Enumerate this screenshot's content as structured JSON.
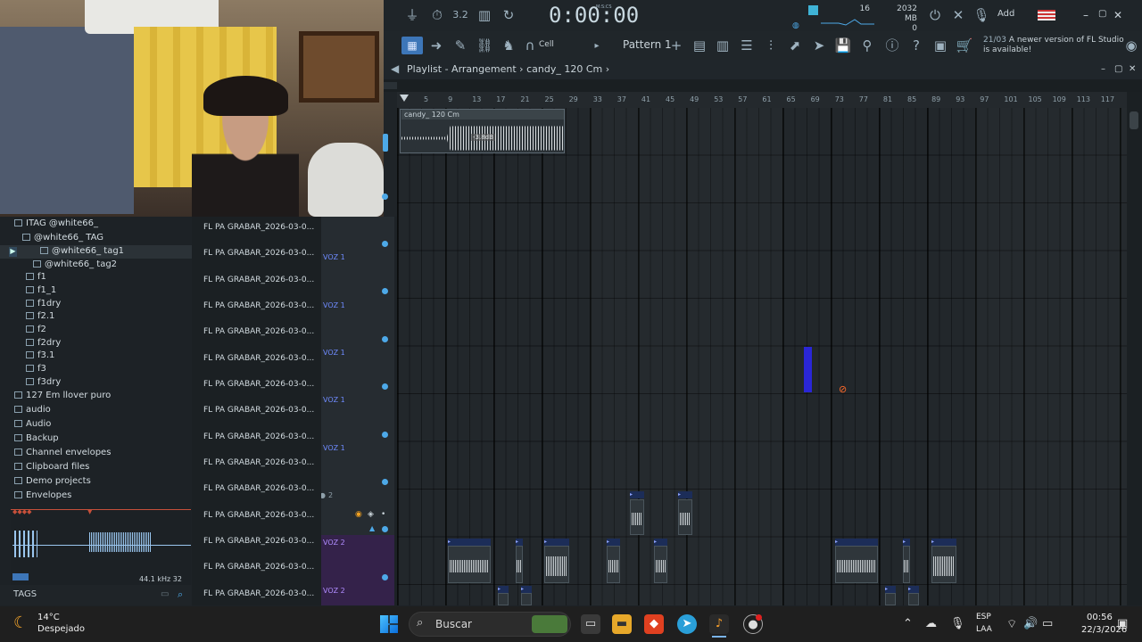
{
  "toolbar": {
    "time": "0:00:00",
    "time_unit": "M:S:CS",
    "cpu_num": "16",
    "memory": "2032 MB",
    "poly": "0",
    "add_label": "Add",
    "cell_label": "Cell",
    "pattern_label": "Pattern 1",
    "hint_date": "21/03",
    "hint_text": "A newer version of FL Studio is available!"
  },
  "playlist": {
    "title": "Playlist - Arrangement",
    "song": "candy_ 120 Cm",
    "ruler": [
      "5",
      "9",
      "13",
      "17",
      "21",
      "25",
      "29",
      "33",
      "37",
      "41",
      "45",
      "49",
      "53",
      "57",
      "61",
      "65",
      "69",
      "73",
      "77",
      "81",
      "85",
      "89",
      "93",
      "97",
      "101",
      "105",
      "109",
      "113",
      "117"
    ],
    "main_clip_title": "candy_ 120 Cm",
    "main_clip_db": "-3.8dB",
    "track_labels": [
      "VOZ 1",
      "VOZ 1",
      "VOZ 1",
      "VOZ 1",
      "VOZ 1",
      "2",
      "VOZ 2",
      "VOZ 2"
    ]
  },
  "browser": {
    "items": [
      "ITAG @white66_",
      "@white66_ TAG",
      "@white66_ tag1",
      "@white66_ tag2",
      "f1",
      "f1_1",
      "f1dry",
      "f2.1",
      "f2",
      "f2dry",
      "f3.1",
      "f3",
      "f3dry",
      "127 Em llover puro",
      "audio",
      "Audio",
      "Backup",
      "Channel envelopes",
      "Clipboard files",
      "Demo projects",
      "Envelopes"
    ],
    "sample_info": "44.1 kHz 32",
    "tags_label": "TAGS"
  },
  "files": [
    "FL PA GRABAR_2026-03-0...",
    "FL PA GRABAR_2026-03-0...",
    "FL PA GRABAR_2026-03-0...",
    "FL PA GRABAR_2026-03-0...",
    "FL PA GRABAR_2026-03-0...",
    "FL PA GRABAR_2026-03-0...",
    "FL PA GRABAR_2026-03-0...",
    "FL PA GRABAR_2026-03-0...",
    "FL PA GRABAR_2026-03-0...",
    "FL PA GRABAR_2026-03-0...",
    "FL PA GRABAR_2026-03-0...",
    "FL PA GRABAR_2026-03-0...",
    "FL PA GRABAR_2026-03-0...",
    "FL PA GRABAR_2026-03-0...",
    "FL PA GRABAR_2026-03-0..."
  ],
  "taskbar": {
    "temp": "14°C",
    "weather": "Despejado",
    "search_label": "Buscar",
    "lang1": "ESP",
    "lang2": "LAA",
    "time": "00:56",
    "date": "22/3/2026"
  },
  "colors": {
    "accent": "#3d76b8",
    "track_label": "#6f8bff",
    "marker": "#2a26d6"
  }
}
